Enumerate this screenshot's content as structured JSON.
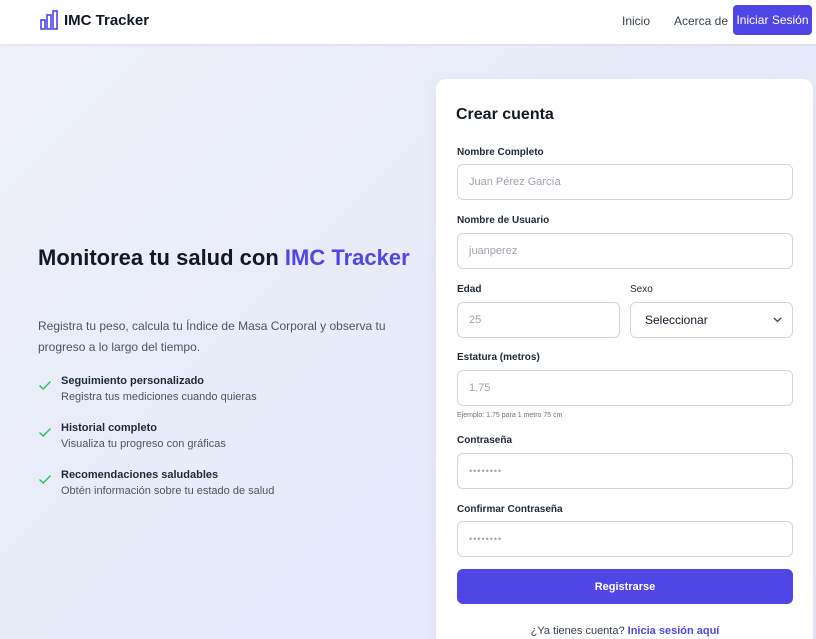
{
  "header": {
    "brand": "IMC Tracker",
    "nav": {
      "home": "Inicio",
      "about": "Acerca de"
    },
    "login_button": "Iniciar Sesión"
  },
  "hero": {
    "title_prefix": "Monitorea tu salud con ",
    "title_accent": "IMC Tracker",
    "description": "Registra tu peso, calcula tu Índice de Masa Corporal y observa tu progreso a lo largo del tiempo.",
    "features": [
      {
        "title": "Seguimiento personalizado",
        "description": "Registra tus mediciones cuando quieras"
      },
      {
        "title": "Historial completo",
        "description": "Visualiza tu progreso con gráficas"
      },
      {
        "title": "Recomendaciones saludables",
        "description": "Obtén información sobre tu estado de salud"
      }
    ]
  },
  "form": {
    "title": "Crear cuenta",
    "full_name": {
      "label": "Nombre Completo",
      "placeholder": "Juan Pérez García",
      "value": ""
    },
    "username": {
      "label": "Nombre de Usuario",
      "placeholder": "juanperez",
      "value": ""
    },
    "age": {
      "label": "Edad",
      "placeholder": "25",
      "value": ""
    },
    "sex": {
      "label": "Sexo",
      "selected": "Seleccionar"
    },
    "height": {
      "label": "Estatura (metros)",
      "placeholder": "1.75",
      "hint": "Ejemplo: 1.75 para 1 metro 75 cm"
    },
    "password": {
      "label": "Contraseña",
      "placeholder": "••••••••"
    },
    "confirm_password": {
      "label": "Confirmar Contraseña",
      "placeholder": "••••••••"
    },
    "submit": "Registrarse",
    "login_prompt": "¿Ya tienes cuenta? ",
    "login_link": "Inicia sesión aquí"
  },
  "colors": {
    "accent": "#4f46e5",
    "check": "#22c55e"
  },
  "icons": {
    "brand": "bar-chart-icon",
    "feature": "check-icon",
    "select": "chevron-down-icon"
  }
}
